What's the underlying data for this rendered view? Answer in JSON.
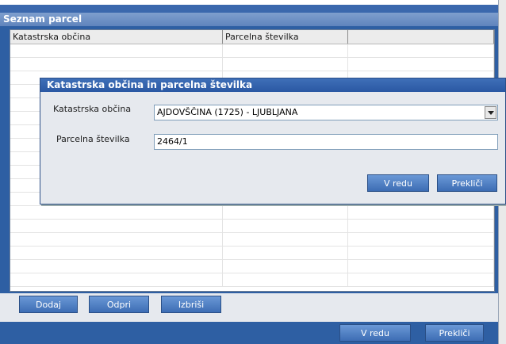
{
  "window": {
    "title": "Seznam parcel"
  },
  "grid": {
    "headers": [
      "Katastrska občina",
      "Parcelna številka",
      ""
    ]
  },
  "buttons": {
    "add": "Dodaj",
    "open": "Odpri",
    "delete": "Izbriši"
  },
  "footer": {
    "ok": "V redu",
    "cancel": "Prekliči"
  },
  "dialog": {
    "title": "Katastrska občina in parcelna številka",
    "municipality_label": "Katastrska občina",
    "municipality_value": "AJDOVŠČINA (1725) - LJUBLJANA",
    "parcel_label": "Parcelna številka",
    "parcel_value": "2464/1",
    "ok": "V redu",
    "cancel": "Prekliči"
  }
}
